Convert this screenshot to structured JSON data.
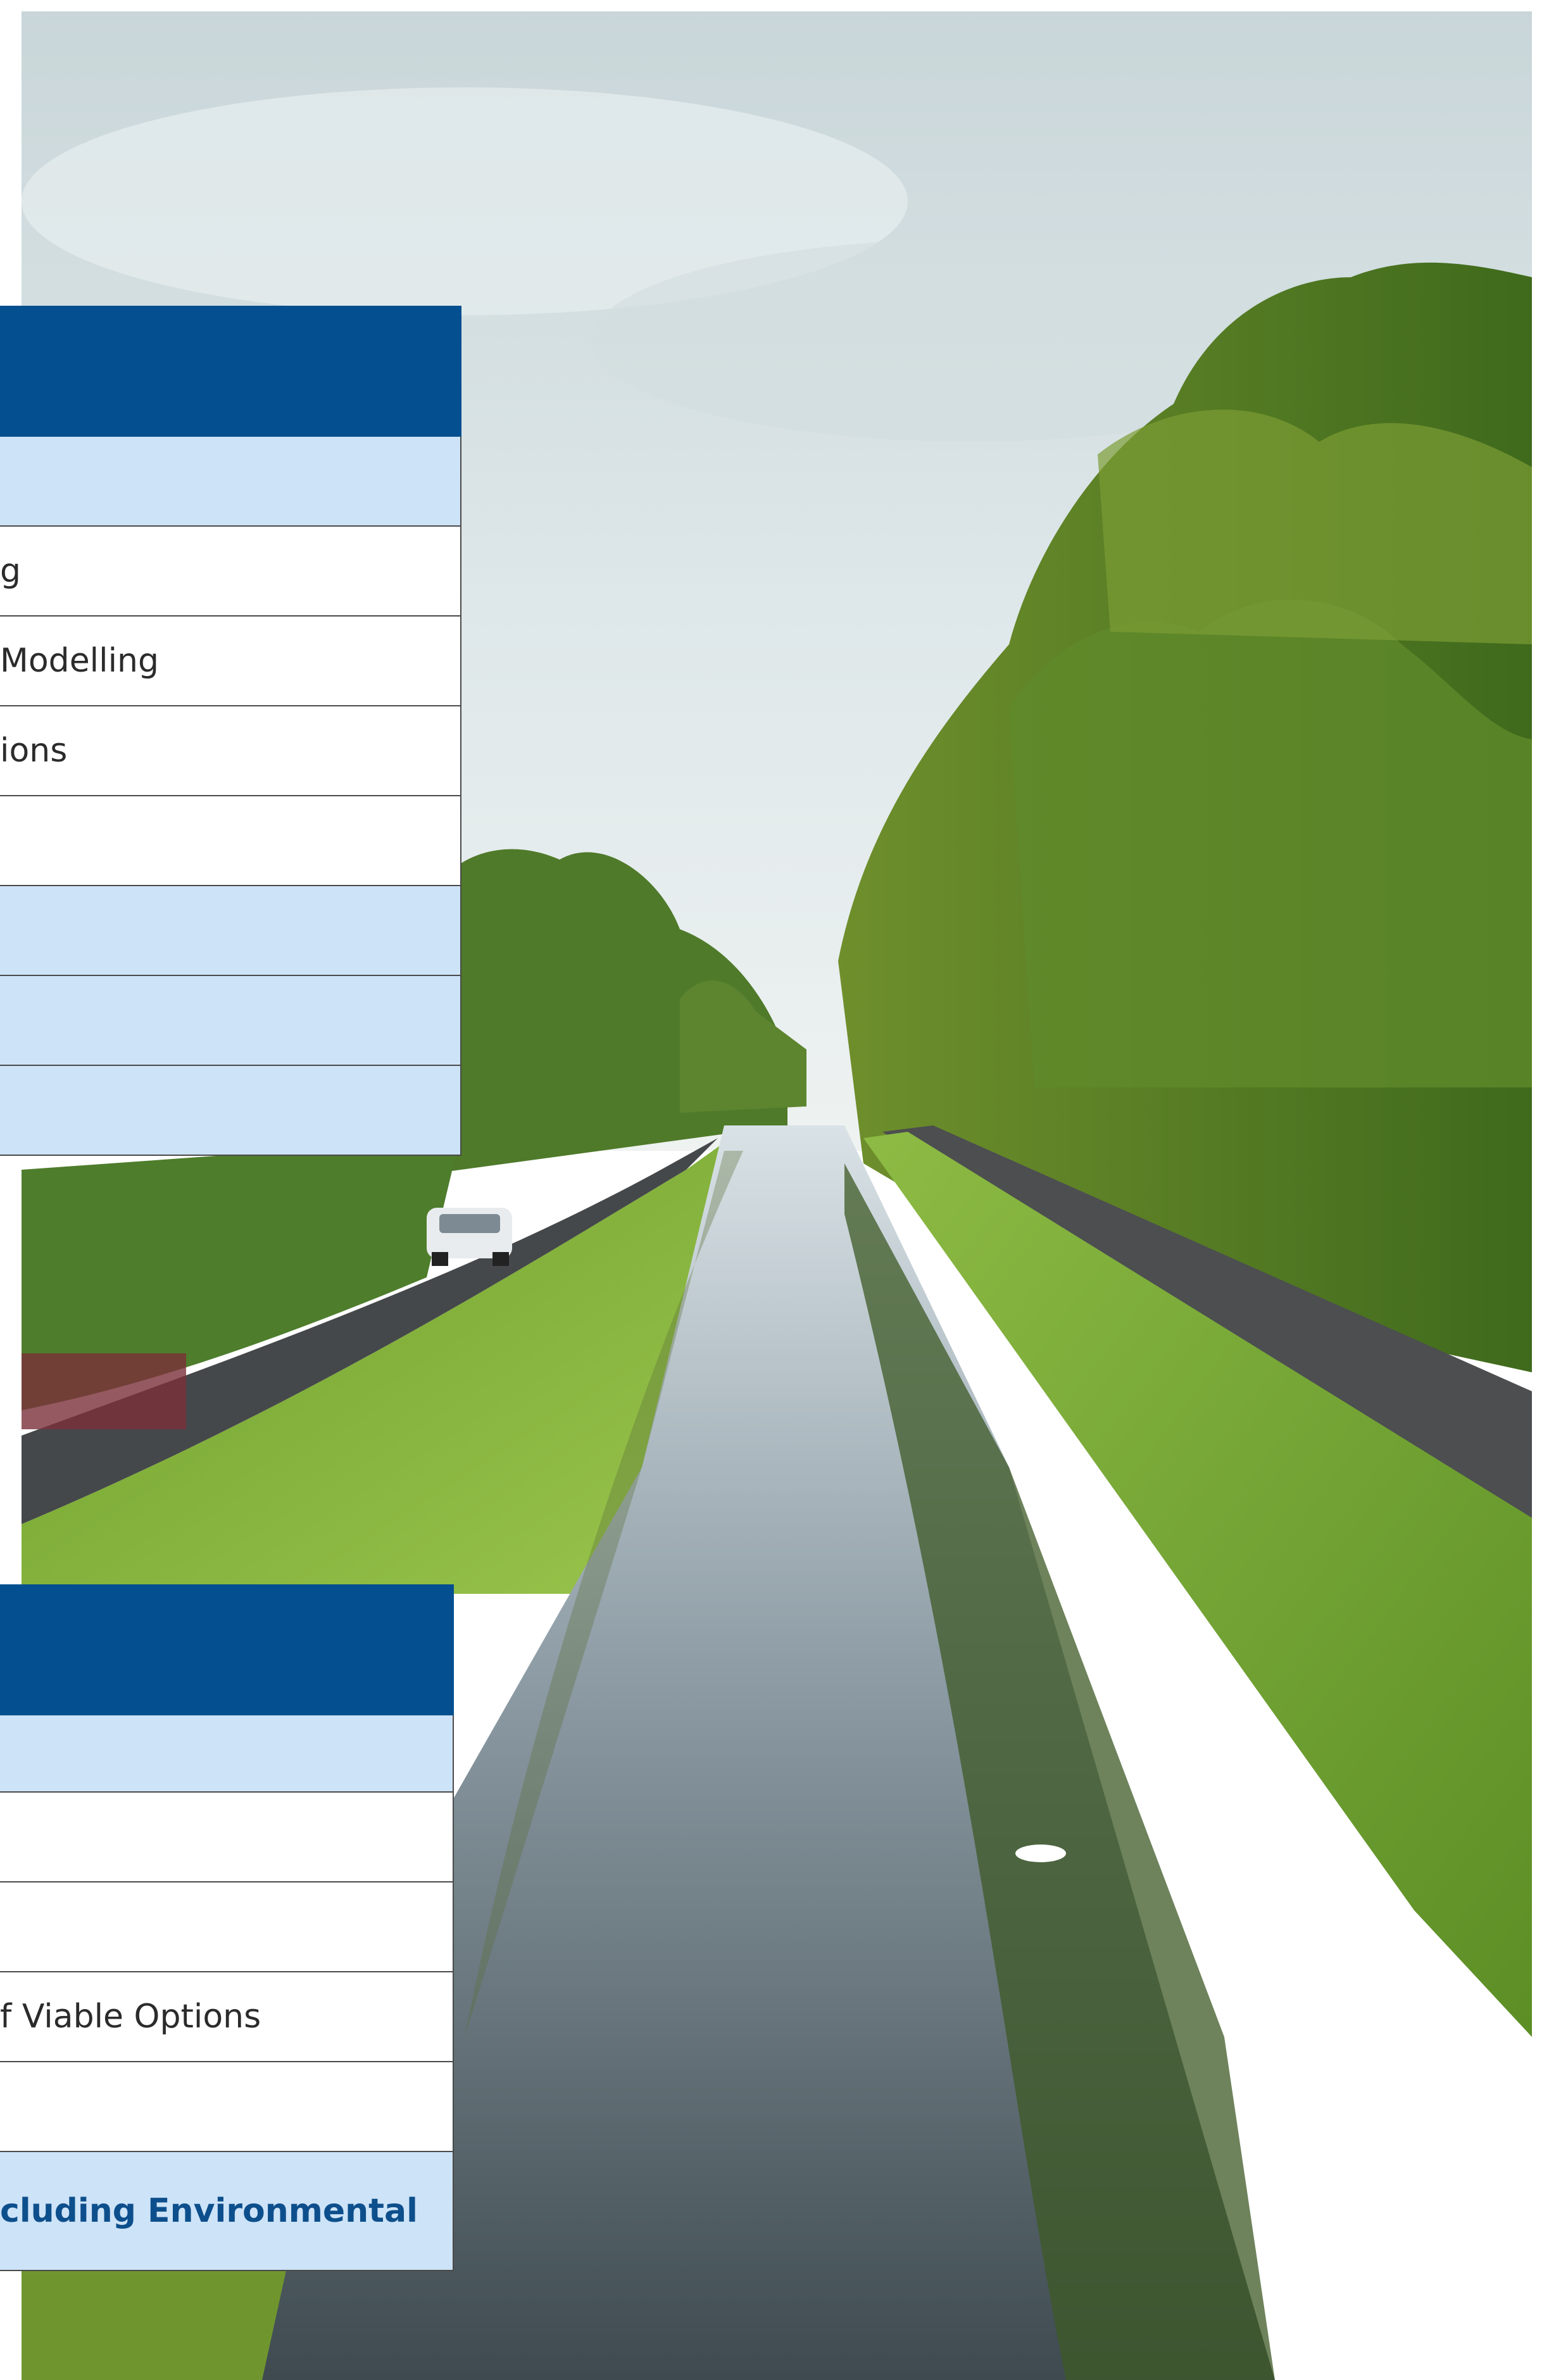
{
  "panel_1": {
    "rows": [
      {
        "text": "",
        "style": "blue"
      },
      {
        "text": "g",
        "style": "white"
      },
      {
        "text": "Modelling",
        "style": "white"
      },
      {
        "text": "ions",
        "style": "white"
      },
      {
        "text": "",
        "style": "white"
      },
      {
        "text": "",
        "style": "blue"
      },
      {
        "text": "",
        "style": "blue"
      },
      {
        "text": "",
        "style": "blue"
      }
    ]
  },
  "panel_2": {
    "rows": [
      {
        "text": "",
        "style": "blue"
      },
      {
        "text": "",
        "style": "white"
      },
      {
        "text": "",
        "style": "white"
      },
      {
        "text": "f Viable Options",
        "style": "white"
      },
      {
        "text": "",
        "style": "white"
      },
      {
        "text": "cluding Environmental",
        "style": "blue-bold"
      }
    ]
  },
  "colors": {
    "header_blue": "#044f8f",
    "row_light_blue": "#cde3f7",
    "row_white": "#ffffff",
    "bold_text_blue": "#0d4f8c"
  },
  "photo": {
    "icon": "canal-landscape-photo"
  }
}
